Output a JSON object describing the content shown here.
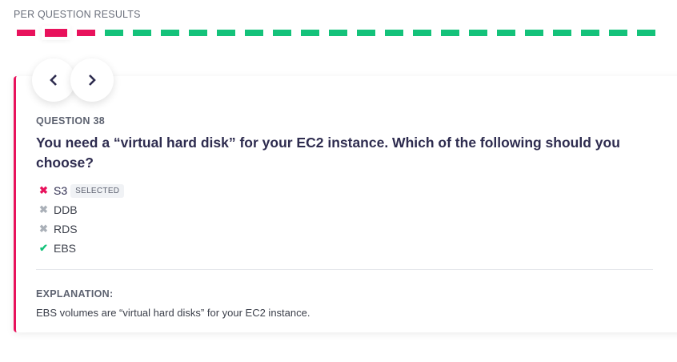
{
  "header": "PER QUESTION RESULTS",
  "results": [
    "wrong",
    "wrong",
    "wrong",
    "correct",
    "correct",
    "correct",
    "correct",
    "correct",
    "correct",
    "correct",
    "correct",
    "correct",
    "correct",
    "correct",
    "correct",
    "correct",
    "correct",
    "correct",
    "correct",
    "correct",
    "correct",
    "correct",
    "correct"
  ],
  "current_index": 1,
  "colors": {
    "wrong": "#e8125c",
    "correct": "#14c27a",
    "neutral": "#aab0b8"
  },
  "question": {
    "number": "QUESTION 38",
    "text": "You need a “virtual hard disk” for your EC2 instance. Which of the following should you choose?",
    "options": [
      {
        "label": "S3",
        "status": "wrong",
        "icon": "x-icon",
        "badge": "SELECTED"
      },
      {
        "label": "DDB",
        "status": "neutral",
        "icon": "x-icon"
      },
      {
        "label": "RDS",
        "status": "neutral",
        "icon": "x-icon"
      },
      {
        "label": "EBS",
        "status": "correct",
        "icon": "check-icon"
      }
    ]
  },
  "explanation": {
    "label": "EXPLANATION:",
    "text": "EBS volumes are “virtual hard disks” for your EC2 instance."
  }
}
